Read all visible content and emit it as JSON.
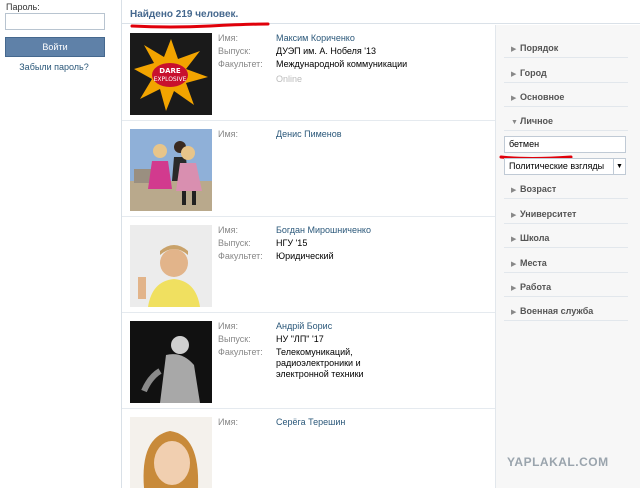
{
  "login": {
    "password_label": "Пароль:",
    "login_button": "Войти",
    "forgot_link": "Забыли пароль?"
  },
  "results": {
    "found_text": "Найдено 219 человек."
  },
  "labels": {
    "name": "Имя:",
    "graduation": "Выпуск:",
    "faculty": "Факультет:"
  },
  "people": [
    {
      "name": "Максим Кориченко",
      "graduation": "ДУЭП им. А. Нобеля '13",
      "faculty": "Международной коммуникации",
      "status": "Online"
    },
    {
      "name": "Денис Пименов"
    },
    {
      "name": "Богдан Мирошниченко",
      "graduation": "НГУ '15",
      "faculty": "Юридический"
    },
    {
      "name": "Андрій Борис",
      "graduation": "НУ \"ЛП\" '17",
      "faculty": "Телекомуникаций, радиоэлектроники и электронной техники"
    },
    {
      "name": "Серёга Терешин"
    }
  ],
  "filters": {
    "order": "Порядок",
    "city": "Город",
    "basic": "Основное",
    "personal": "Личное",
    "personal_input": "бетмен",
    "personal_select": "Политические взгляды",
    "age": "Возраст",
    "university": "Университет",
    "school": "Школа",
    "places": "Места",
    "work": "Работа",
    "military": "Военная служба"
  },
  "watermark": "YAPLAKAL.COM",
  "colors": {
    "accent": "#45688e",
    "link": "#2b587a",
    "annotation": "#e0000a"
  }
}
